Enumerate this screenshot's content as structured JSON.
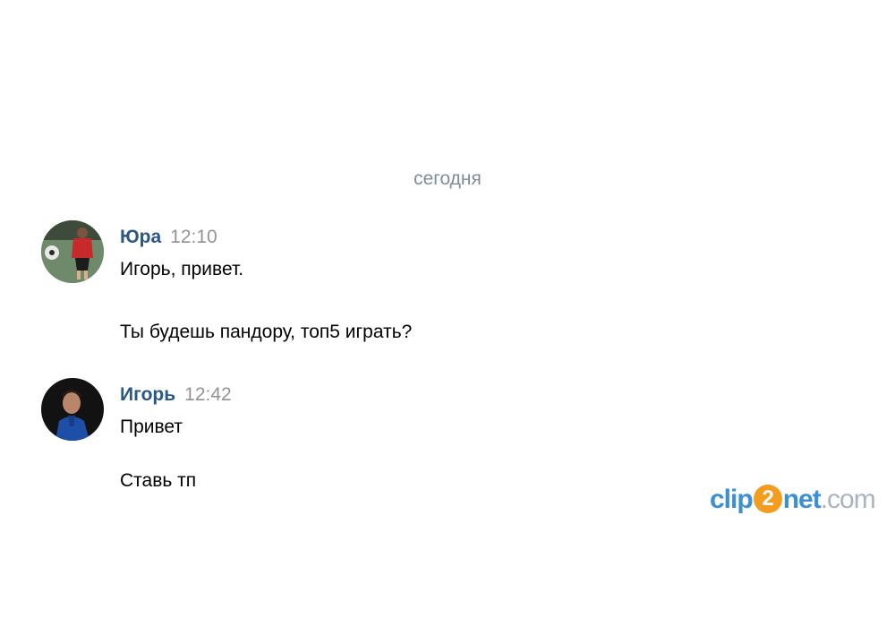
{
  "conversation": {
    "date_divider": "сегодня",
    "messages": [
      {
        "author": "Юра",
        "time": "12:10",
        "avatar_icon": "user-avatar-photo",
        "lines": [
          "Игорь, привет.",
          "Ты будешь пандору, топ5 играть?"
        ]
      },
      {
        "author": "Игорь",
        "time": "12:42",
        "avatar_icon": "user-avatar-photo",
        "lines": [
          "Привет",
          "Ставь тп"
        ]
      }
    ]
  },
  "watermark": {
    "part1": "clip",
    "part2": "2",
    "part3": "net",
    "part4": ".com"
  },
  "colors": {
    "author_name": "#2a5885",
    "timestamp": "#939393",
    "date_divider": "#818c99",
    "watermark_blue": "#3a8fd6",
    "watermark_orange": "#f39c1f"
  }
}
